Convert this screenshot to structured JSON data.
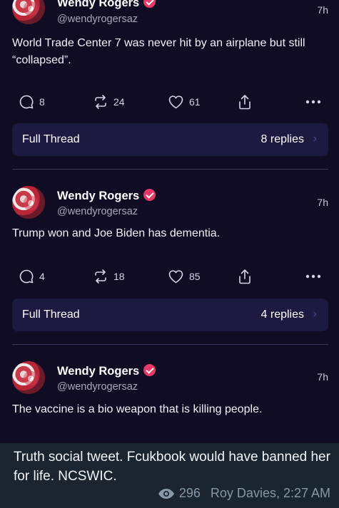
{
  "posts": [
    {
      "author": "Wendy Rogers",
      "handle": "@wendyrogersaz",
      "time": "7h",
      "text": "World Trade Center 7 was never hit by an airplane but still “collapsed”.",
      "replies": "8",
      "reposts": "24",
      "likes": "61",
      "thread_label": "Full Thread",
      "thread_replies": "8 replies"
    },
    {
      "author": "Wendy Rogers",
      "handle": "@wendyrogersaz",
      "time": "7h",
      "text": "Trump won and Joe Biden has dementia.",
      "replies": "4",
      "reposts": "18",
      "likes": "85",
      "thread_label": "Full Thread",
      "thread_replies": "4 replies"
    },
    {
      "author": "Wendy Rogers",
      "handle": "@wendyrogersaz",
      "time": "7h",
      "text": "The vaccine is a bio weapon that is killing people."
    }
  ],
  "caption": {
    "text": "Truth social tweet. Fcukbook would have banned her for life. NCSWIC.",
    "views": "296",
    "author_time": "Roy Davies, 2:27 AM"
  },
  "icons": {
    "reply": "speech-bubble-icon",
    "repost": "repost-arrows-icon",
    "like": "heart-icon",
    "share": "share-upload-icon",
    "more": "more-dots-icon",
    "chevron": "chevron-right-icon",
    "verified": "verified-badge-icon",
    "views": "eye-icon"
  },
  "colors": {
    "background": "#0f0c24",
    "thread_button": "#1d1a42",
    "verified_badge": "#e63967",
    "caption_background": "#1b2530"
  }
}
